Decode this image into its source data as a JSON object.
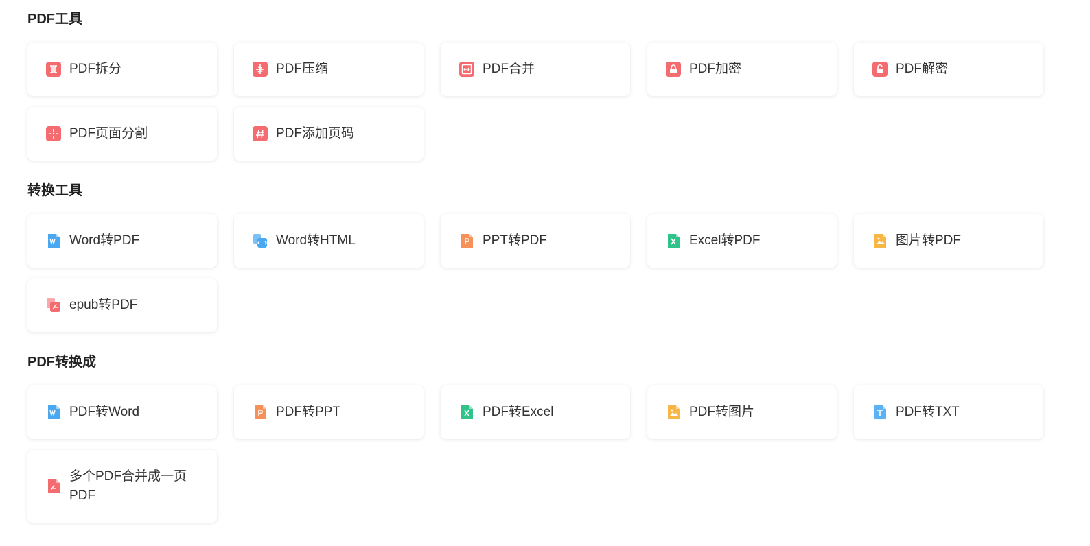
{
  "colors": {
    "pdf_red": "#f46c70",
    "word_blue": "#4aa8f3",
    "ppt_orange": "#f7915a",
    "excel_green": "#2fc38a",
    "image_yellow": "#f8b645",
    "txt_blue": "#5cb2f6"
  },
  "sections": [
    {
      "title": "PDF工具",
      "items": [
        {
          "label": "PDF拆分",
          "icon": "pdf-split-icon"
        },
        {
          "label": "PDF压缩",
          "icon": "pdf-compress-icon"
        },
        {
          "label": "PDF合并",
          "icon": "pdf-merge-icon"
        },
        {
          "label": "PDF加密",
          "icon": "lock-icon"
        },
        {
          "label": "PDF解密",
          "icon": "unlock-icon"
        },
        {
          "label": "PDF页面分割",
          "icon": "page-split-icon"
        },
        {
          "label": "PDF添加页码",
          "icon": "hash-icon"
        }
      ]
    },
    {
      "title": "转换工具",
      "items": [
        {
          "label": "Word转PDF",
          "icon": "word-doc-icon"
        },
        {
          "label": "Word转HTML",
          "icon": "word-html-icon"
        },
        {
          "label": "PPT转PDF",
          "icon": "ppt-doc-icon"
        },
        {
          "label": "Excel转PDF",
          "icon": "excel-doc-icon"
        },
        {
          "label": "图片转PDF",
          "icon": "image-doc-icon"
        },
        {
          "label": "epub转PDF",
          "icon": "epub-pdf-icon"
        }
      ]
    },
    {
      "title": "PDF转换成",
      "items": [
        {
          "label": "PDF转Word",
          "icon": "word-doc-icon"
        },
        {
          "label": "PDF转PPT",
          "icon": "ppt-doc-icon"
        },
        {
          "label": "PDF转Excel",
          "icon": "excel-doc-icon"
        },
        {
          "label": "PDF转图片",
          "icon": "image-doc-icon"
        },
        {
          "label": "PDF转TXT",
          "icon": "txt-doc-icon"
        },
        {
          "label": "多个PDF合并成一页PDF",
          "icon": "pdf-file-icon"
        }
      ]
    }
  ]
}
